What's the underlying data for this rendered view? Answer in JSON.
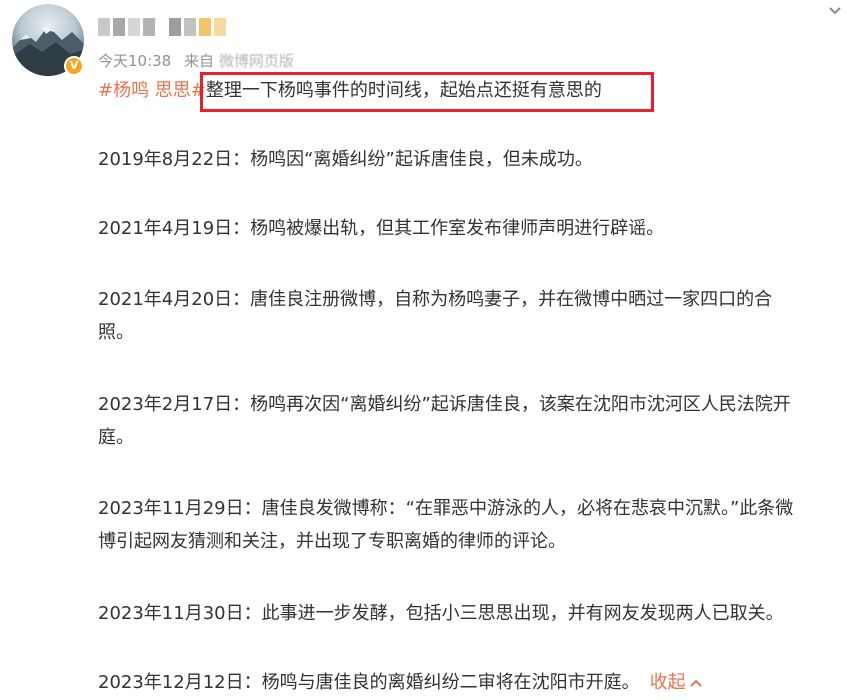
{
  "post": {
    "timestamp": "今天10:38",
    "source_prefix": "来自",
    "source_name": "微博网页版",
    "hashtag": "#杨鸣 思思#",
    "title": "整理一下杨鸣事件的时间线，起始点还挺有意思的",
    "entries": [
      {
        "lines": [
          "2019年8月22日：杨鸣因“离婚纠纷”起诉唐佳良，但未成功。"
        ]
      },
      {
        "lines": [
          "2021年4月19日：杨鸣被爆出轨，但其工作室发布律师声明进行辟谣。"
        ]
      },
      {
        "lines": [
          "2021年4月20日：唐佳良注册微博，自称为杨鸣妻子，并在微博中晒过一家四口的合",
          "照。"
        ]
      },
      {
        "lines": [
          "2023年2月17日：杨鸣再次因“离婚纠纷”起诉唐佳良，该案在沈阳市沈河区人民法院开",
          "庭。"
        ]
      },
      {
        "lines": [
          "2023年11月29日：唐佳良发微博称：“在罪恶中游泳的人，必将在悲哀中沉默。”此条微",
          "博引起网友猜测和关注，并出现了专职离婚的律师的评论。"
        ]
      },
      {
        "lines": [
          "2023年11月30日：此事进一步发酵，包括小三思思出现，并有网友发现两人已取关。"
        ]
      },
      {
        "lines": [
          "2023年12月12日：杨鸣与唐佳良的离婚纠纷二审将在沈阳市开庭。"
        ]
      }
    ],
    "collapse_label": "收起",
    "collapse_icon": "chevron-up-icon"
  },
  "colors": {
    "hashtag": "#eb7350",
    "highlight_border": "#e8202a",
    "meta_text": "#939393",
    "body_text": "#333333",
    "verified": "#f6a623"
  }
}
